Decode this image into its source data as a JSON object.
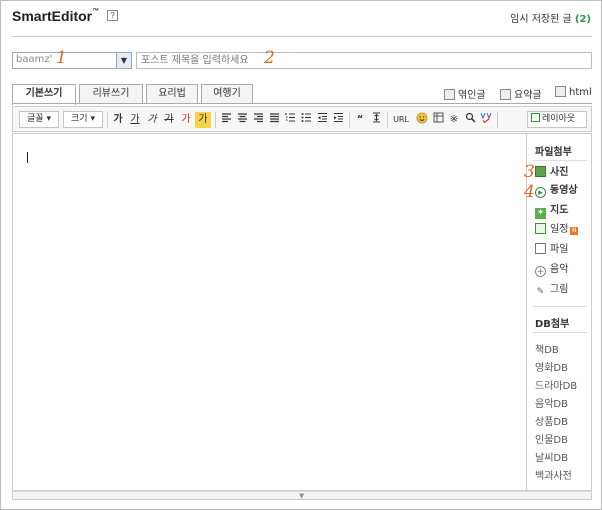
{
  "header": {
    "logo_main": "SmartEditor",
    "logo_tm": "™",
    "help_icon": "?",
    "saved_label": "임시 저장된 글",
    "saved_count": "(2)"
  },
  "post": {
    "blog_select_value": "baamz'",
    "title_placeholder": "포스트 제목을 입력하세요",
    "markers": [
      "1",
      "2",
      "3",
      "4"
    ]
  },
  "tabs": [
    {
      "label": "기본쓰기",
      "active": true
    },
    {
      "label": "리뷰쓰기",
      "active": false
    },
    {
      "label": "요리법",
      "active": false
    },
    {
      "label": "여행기",
      "active": false
    }
  ],
  "options": [
    "엮인글",
    "요약글",
    "html"
  ],
  "toolbar": {
    "font_label": "글꼴",
    "size_label": "크기",
    "style_glyphs": [
      "가",
      "가",
      "가",
      "가",
      "가",
      "가"
    ],
    "url_label": "URL",
    "layout_label": "레이아웃",
    "icons": [
      "bold-icon",
      "underline-icon",
      "italic-icon",
      "strikethrough-icon",
      "font-color-icon",
      "highlight-icon",
      "align-left-icon",
      "align-center-icon",
      "align-right-icon",
      "justify-icon",
      "numbered-list-icon",
      "bullet-list-icon",
      "outdent-icon",
      "indent-icon",
      "quote-icon",
      "line-height-icon",
      "emoticon-icon",
      "table-icon",
      "special-char-icon",
      "find-icon",
      "spellcheck-icon"
    ]
  },
  "sidebar": {
    "attach_title": "파일첨부",
    "attach_items": [
      {
        "label": "사진",
        "icon": "photo-icon"
      },
      {
        "label": "동영상",
        "icon": "video-icon"
      },
      {
        "label": "지도",
        "icon": "map-icon"
      },
      {
        "label": "일정",
        "icon": "calendar-icon",
        "badge": "N"
      },
      {
        "label": "파일",
        "icon": "file-icon"
      },
      {
        "label": "음악",
        "icon": "music-icon"
      },
      {
        "label": "그림",
        "icon": "drawing-icon"
      }
    ],
    "db_title": "DB첨부",
    "db_items": [
      "책DB",
      "영화DB",
      "드라마DB",
      "음악DB",
      "상품DB",
      "인물DB",
      "날씨DB",
      "백과사전"
    ]
  },
  "colors": {
    "accent_green": "#2a9d3a",
    "marker_orange": "#e2662a",
    "font_red": "#d42b2b",
    "highlight_yellow": "#f5d24a"
  }
}
